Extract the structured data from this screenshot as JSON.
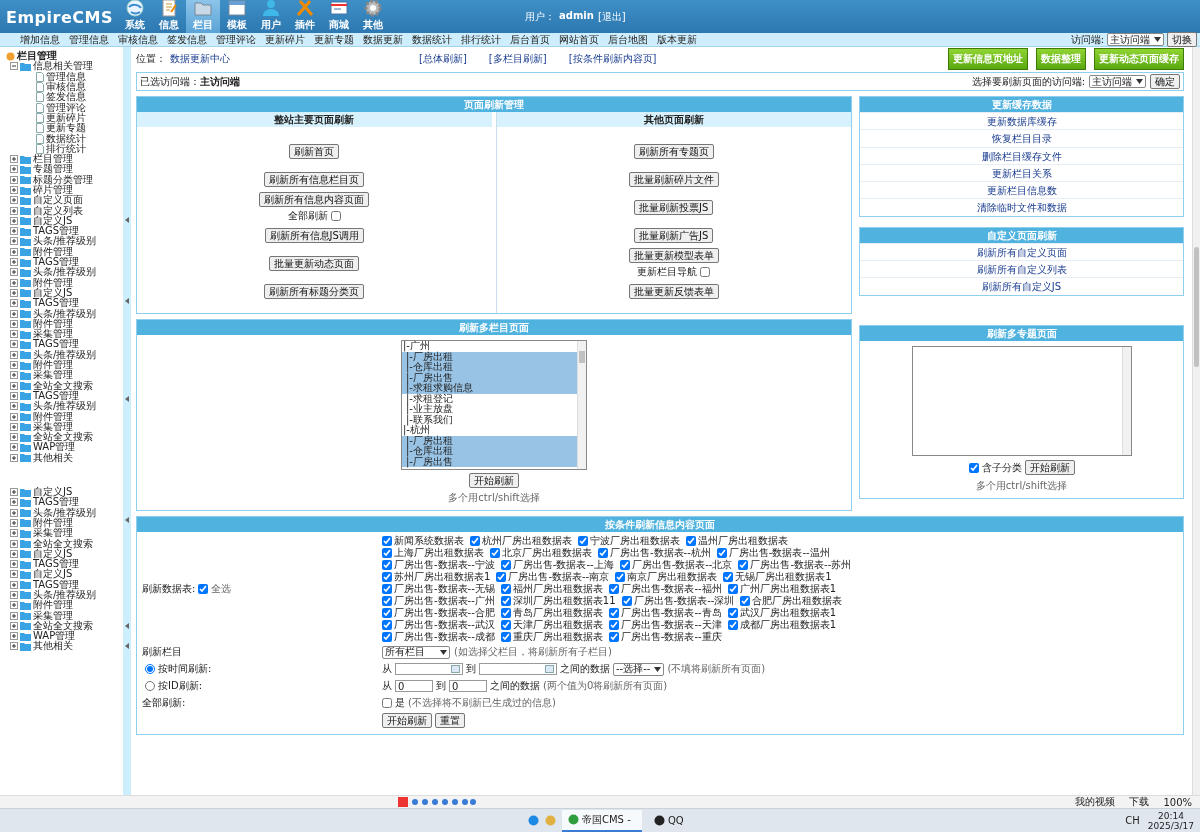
{
  "header": {
    "logo": "EmpireCMS",
    "modules": [
      {
        "label": "系统",
        "selected": false
      },
      {
        "label": "信息",
        "selected": false
      },
      {
        "label": "栏目",
        "selected": true
      },
      {
        "label": "模板",
        "selected": false
      },
      {
        "label": "用户",
        "selected": false
      },
      {
        "label": "插件",
        "selected": false
      },
      {
        "label": "商城",
        "selected": false
      },
      {
        "label": "其他",
        "selected": false
      }
    ],
    "user_label": "用户：",
    "user": "admin",
    "logout": "[退出]"
  },
  "nav": {
    "links": [
      "增加信息",
      "管理信息",
      "审核信息",
      "签发信息",
      "管理评论",
      "更新碎片",
      "更新专题",
      "数据更新",
      "数据统计",
      "排行统计",
      "后台首页",
      "网站首页",
      "后台地图",
      "版本更新"
    ],
    "access_label": "访问端:",
    "access_value": "主访问端",
    "switch_button": "切换"
  },
  "sidebar": {
    "title": "栏目管理",
    "items": [
      {
        "label": "信息相关管理",
        "expanded": true,
        "children": [
          {
            "label": "管理信息"
          },
          {
            "label": "审核信息"
          },
          {
            "label": "签发信息"
          },
          {
            "label": "管理评论"
          },
          {
            "label": "更新碎片"
          },
          {
            "label": "更新专题"
          },
          {
            "label": "数据统计"
          },
          {
            "label": "排行统计"
          }
        ]
      },
      {
        "label": "栏目管理",
        "expanded": false
      },
      {
        "label": "专题管理",
        "expanded": false
      },
      {
        "label": "标题分类管理",
        "expanded": false
      },
      {
        "label": "碎片管理",
        "expanded": false
      },
      {
        "label": "自定义页面",
        "expanded": false
      },
      {
        "label": "自定义列表",
        "expanded": false
      },
      {
        "label": "自定义JS",
        "expanded": false
      },
      {
        "label": "TAGS管理",
        "expanded": false
      },
      {
        "label": "头条/推荐级别",
        "expanded": false
      },
      {
        "label": "附件管理",
        "expanded": false
      },
      {
        "label": "TAGS管理",
        "expanded": false
      },
      {
        "label": "头条/推荐级别",
        "expanded": false
      },
      {
        "label": "附件管理",
        "expanded": false
      },
      {
        "label": "自定义JS",
        "expanded": false
      },
      {
        "label": "TAGS管理",
        "expanded": false
      },
      {
        "label": "头条/推荐级别",
        "expanded": false
      },
      {
        "label": "附件管理",
        "expanded": false
      },
      {
        "label": "采集管理",
        "expanded": false
      },
      {
        "label": "TAGS管理",
        "expanded": false
      },
      {
        "label": "头条/推荐级别",
        "expanded": false
      },
      {
        "label": "附件管理",
        "expanded": false
      },
      {
        "label": "采集管理",
        "expanded": false
      },
      {
        "label": "全站全文搜索",
        "expanded": false
      },
      {
        "label": "TAGS管理",
        "expanded": false
      },
      {
        "label": "头条/推荐级别",
        "expanded": false
      },
      {
        "label": "附件管理",
        "expanded": false
      },
      {
        "label": "采集管理",
        "expanded": false
      },
      {
        "label": "全站全文搜索",
        "expanded": false
      },
      {
        "label": "WAP管理",
        "expanded": false
      },
      {
        "label": "其他相关",
        "expanded": false
      }
    ],
    "items_2": [
      {
        "label": "自定义JS",
        "expanded": false
      },
      {
        "label": "TAGS管理",
        "expanded": false
      },
      {
        "label": "头条/推荐级别",
        "expanded": false
      },
      {
        "label": "附件管理",
        "expanded": false
      },
      {
        "label": "采集管理",
        "expanded": false
      },
      {
        "label": "全站全文搜索",
        "expanded": false
      },
      {
        "label": "自定义JS",
        "expanded": false
      },
      {
        "label": "TAGS管理",
        "expanded": false
      },
      {
        "label": "自定义JS",
        "expanded": false
      },
      {
        "label": "TAGS管理",
        "expanded": false
      },
      {
        "label": "头条/推荐级别",
        "expanded": false
      },
      {
        "label": "附件管理",
        "expanded": false
      },
      {
        "label": "采集管理",
        "expanded": false
      },
      {
        "label": "全站全文搜索",
        "expanded": false
      },
      {
        "label": "WAP管理",
        "expanded": false
      },
      {
        "label": "其他相关",
        "expanded": false
      }
    ]
  },
  "main": {
    "location_label": "位置：",
    "location": "数据更新中心",
    "links": [
      "[总体刷新]",
      "[多栏目刷新]",
      "[按条件刷新内容页]"
    ],
    "actions": [
      "更新信息页地址",
      "数据整理",
      "更新动态页面缓存"
    ],
    "access_bar": {
      "selected_label": "已选访问端：",
      "selected_value": "主访问端",
      "choose_label": "选择要刷新页面的访问端:",
      "choose_value": "主访问端",
      "confirm": "确定"
    },
    "page_refresh": {
      "title": "页面刷新管理",
      "columns": [
        {
          "heading": "整站主要页面刷新",
          "items": [
            {
              "kind": "button",
              "label": "刷新首页"
            },
            {
              "kind": "button",
              "label": "刷新所有信息栏目页"
            },
            {
              "kind": "button_check",
              "label": "刷新所有信息内容页面",
              "check_label": "全部刷新",
              "checked": false
            },
            {
              "kind": "button",
              "label": "刷新所有信息JS调用"
            },
            {
              "kind": "button",
              "label": "批量更新动态页面"
            },
            {
              "kind": "button",
              "label": "刷新所有标题分类页"
            }
          ]
        },
        {
          "heading": "其他页面刷新",
          "items": [
            {
              "kind": "button",
              "label": "刷新所有专题页"
            },
            {
              "kind": "button",
              "label": "批量刷新碎片文件"
            },
            {
              "kind": "button",
              "label": "批量刷新投票JS"
            },
            {
              "kind": "button",
              "label": "批量刷新广告JS"
            },
            {
              "kind": "button_check",
              "label": "批量更新模型表单",
              "check_label": "更新栏目导航",
              "checked": false
            },
            {
              "kind": "button",
              "label": "批量更新反馈表单"
            }
          ]
        }
      ]
    },
    "cache": {
      "title": "更新缓存数据",
      "links": [
        "更新数据库缓存",
        "恢复栏目目录",
        "删除栏目缓存文件",
        "更新栏目关系",
        "更新栏目信息数",
        "清除临时文件和数据"
      ]
    },
    "custom": {
      "title": "自定义页面刷新",
      "links": [
        "刷新所有自定义页面",
        "刷新所有自定义列表",
        "刷新所有自定义JS"
      ]
    },
    "multi_column": {
      "title": "刷新多栏目页面",
      "options": [
        {
          "label": "|-广州",
          "selected": false,
          "children": [
            {
              "label": "|-厂房出租",
              "selected": true
            },
            {
              "label": "|-仓库出租",
              "selected": true
            },
            {
              "label": "|-厂房出售",
              "selected": true
            },
            {
              "label": "|-求租求购信息",
              "selected": true
            },
            {
              "label": "|-求租登记",
              "selected": false
            },
            {
              "label": "|-业主放盘",
              "selected": false
            },
            {
              "label": "|-联系我们",
              "selected": false
            }
          ]
        },
        {
          "label": "|-杭州",
          "selected": false,
          "children": [
            {
              "label": "|-厂房出租",
              "selected": true
            },
            {
              "label": "|-仓库出租",
              "selected": true
            },
            {
              "label": "|-厂房出售",
              "selected": true
            }
          ]
        }
      ],
      "button": "开始刷新",
      "hint": "多个用ctrl/shift选择"
    },
    "multi_topic": {
      "title": "刷新多专题页面",
      "include_label": "含子分类",
      "include_checked": true,
      "button": "开始刷新",
      "hint": "多个用ctrl/shift选择"
    },
    "condition": {
      "title": "按条件刷新信息内容页面",
      "tables_label": "刷新数据表:",
      "all_label": "全选",
      "all_checked": true,
      "tables": [
        {
          "label": "新闻系统数据表",
          "checked": true
        },
        {
          "label": "杭州厂房出租数据表",
          "checked": true
        },
        {
          "label": "宁波厂房出租数据表",
          "checked": true
        },
        {
          "label": "温州厂房出租数据表",
          "checked": true
        },
        {
          "label": "上海厂房出租数据表",
          "checked": true
        },
        {
          "label": "北京厂房出租数据表",
          "checked": true
        },
        {
          "label": "厂房出售-数据表--杭州",
          "checked": true
        },
        {
          "label": "厂房出售-数据表--温州",
          "checked": true
        },
        {
          "label": "厂房出售-数据表--宁波",
          "checked": true
        },
        {
          "label": "厂房出售-数据表--上海",
          "checked": true
        },
        {
          "label": "厂房出售-数据表--北京",
          "checked": true
        },
        {
          "label": "厂房出售-数据表--苏州",
          "checked": true
        },
        {
          "label": "苏州厂房出租数据表1",
          "checked": true
        },
        {
          "label": "厂房出售-数据表--南京",
          "checked": true
        },
        {
          "label": "南京厂房出租数据表",
          "checked": true
        },
        {
          "label": "无锡厂房出租数据表1",
          "checked": true
        },
        {
          "label": "厂房出售-数据表--无锡",
          "checked": true
        },
        {
          "label": "福州厂房出租数据表",
          "checked": true
        },
        {
          "label": "厂房出售-数据表--福州",
          "checked": true
        },
        {
          "label": "广州厂房出租数据表1",
          "checked": true
        },
        {
          "label": "厂房出售-数据表--广州",
          "checked": true
        },
        {
          "label": "深圳厂房出租数据表11",
          "checked": true
        },
        {
          "label": "厂房出售-数据表--深圳",
          "checked": true
        },
        {
          "label": "合肥厂房出租数据表",
          "checked": true
        },
        {
          "label": "厂房出售-数据表--合肥",
          "checked": true
        },
        {
          "label": "青岛厂房出租数据表",
          "checked": true
        },
        {
          "label": "厂房出售-数据表--青岛",
          "checked": true
        },
        {
          "label": "武汉厂房出租数据表1",
          "checked": true
        },
        {
          "label": "厂房出售-数据表--武汉",
          "checked": true
        },
        {
          "label": "天津厂房出租数据表",
          "checked": true
        },
        {
          "label": "厂房出售-数据表--天津",
          "checked": true
        },
        {
          "label": "成都厂房出租数据表1",
          "checked": true
        },
        {
          "label": "厂房出售-数据表--成都",
          "checked": true
        },
        {
          "label": "重庆厂房出租数据表",
          "checked": true
        },
        {
          "label": "厂房出售-数据表--重庆",
          "checked": true
        }
      ],
      "column_label": "刷新栏目",
      "column_value": "所有栏目",
      "column_note": "(如选择父栏目，将刷新所有子栏目)",
      "by_time": {
        "label": "按时间刷新:",
        "selected": true,
        "from": "从",
        "to": "到",
        "between": "之间的数据",
        "select": "--选择--",
        "note": "(不填将刷新所有页面)"
      },
      "by_id": {
        "label": "按ID刷新:",
        "selected": false,
        "from": "从",
        "from_value": "0",
        "to": "到",
        "to_value": "0",
        "between": "之间的数据",
        "note": "(两个值为0将刷新所有页面)"
      },
      "full_label": "全部刷新:",
      "full_checkbox_label": "是",
      "full_checked": false,
      "full_note": "(不选择将不刷新已生成过的信息)",
      "buttons": [
        "开始刷新",
        "重置"
      ]
    }
  },
  "status_bar": {
    "items": [
      "我的视频",
      "下载",
      "100%"
    ]
  },
  "taskbar": {
    "apps": [
      {
        "label": "帝国CMS -",
        "selected": true
      },
      {
        "label": "QQ",
        "selected": false
      }
    ],
    "lang": "CH",
    "time": "20:14",
    "date": "2025/3/17"
  }
}
